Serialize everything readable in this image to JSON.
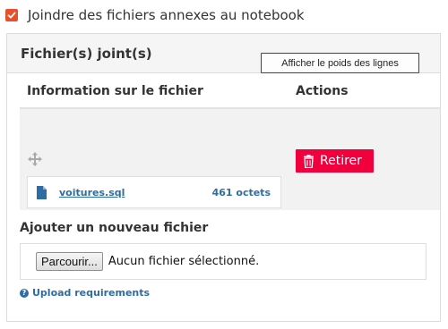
{
  "attach": {
    "label": "Joindre des fichiers annexes au notebook",
    "checked": true,
    "color": "#e8502b"
  },
  "panel": {
    "title": "Fichier(s) joint(s)",
    "weight_button": "Afficher le poids des lignes",
    "columns": {
      "info": "Information sur le fichier",
      "actions": "Actions"
    },
    "file": {
      "name": "voitures.sql",
      "size": "461 octets",
      "icon": "file-icon"
    },
    "remove_button": "Retirer",
    "remove_color": "#f0003c",
    "add_title": "Ajouter un nouveau fichier",
    "browse_button": "Parcourir...",
    "no_file_text": "Aucun fichier sélectionné.",
    "upload_link": "Upload requirements",
    "link_color": "#2e6da4"
  }
}
